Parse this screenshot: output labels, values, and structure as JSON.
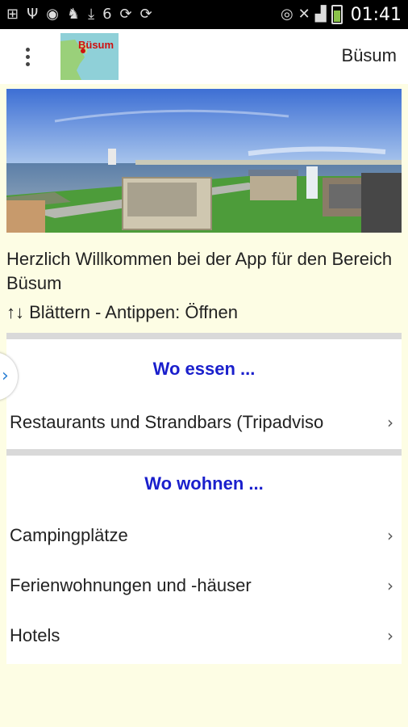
{
  "status_bar": {
    "time": "01:41",
    "notification_count": "6",
    "icons_left": [
      "add-box-icon",
      "usb-icon",
      "sync-icon",
      "cat-icon",
      "download-icon",
      "weather-icon",
      "refresh-icon",
      "refresh-icon"
    ],
    "icons_right": [
      "eye-icon",
      "mute-icon",
      "wifi-icon",
      "signal-icon",
      "battery-icon"
    ]
  },
  "app_bar": {
    "title": "Büsum",
    "logo_text": "Büsum"
  },
  "welcome": {
    "text": "Herzlich Willkommen bei der App für den Bereich Büsum",
    "hint": "↑↓ Blättern - Antippen: Öffnen"
  },
  "sections": [
    {
      "title": "Wo essen ...",
      "items": [
        {
          "label": "Restaurants und Strandbars (Tripadviso"
        }
      ]
    },
    {
      "title": "Wo wohnen ...",
      "items": [
        {
          "label": "Campingplätze"
        },
        {
          "label": "Ferienwohnungen und -häuser"
        },
        {
          "label": "Hotels"
        }
      ]
    }
  ],
  "colors": {
    "page_background": "#fdfde4",
    "section_title": "#1a1fcc",
    "edge_chevron": "#2a7fd4"
  }
}
